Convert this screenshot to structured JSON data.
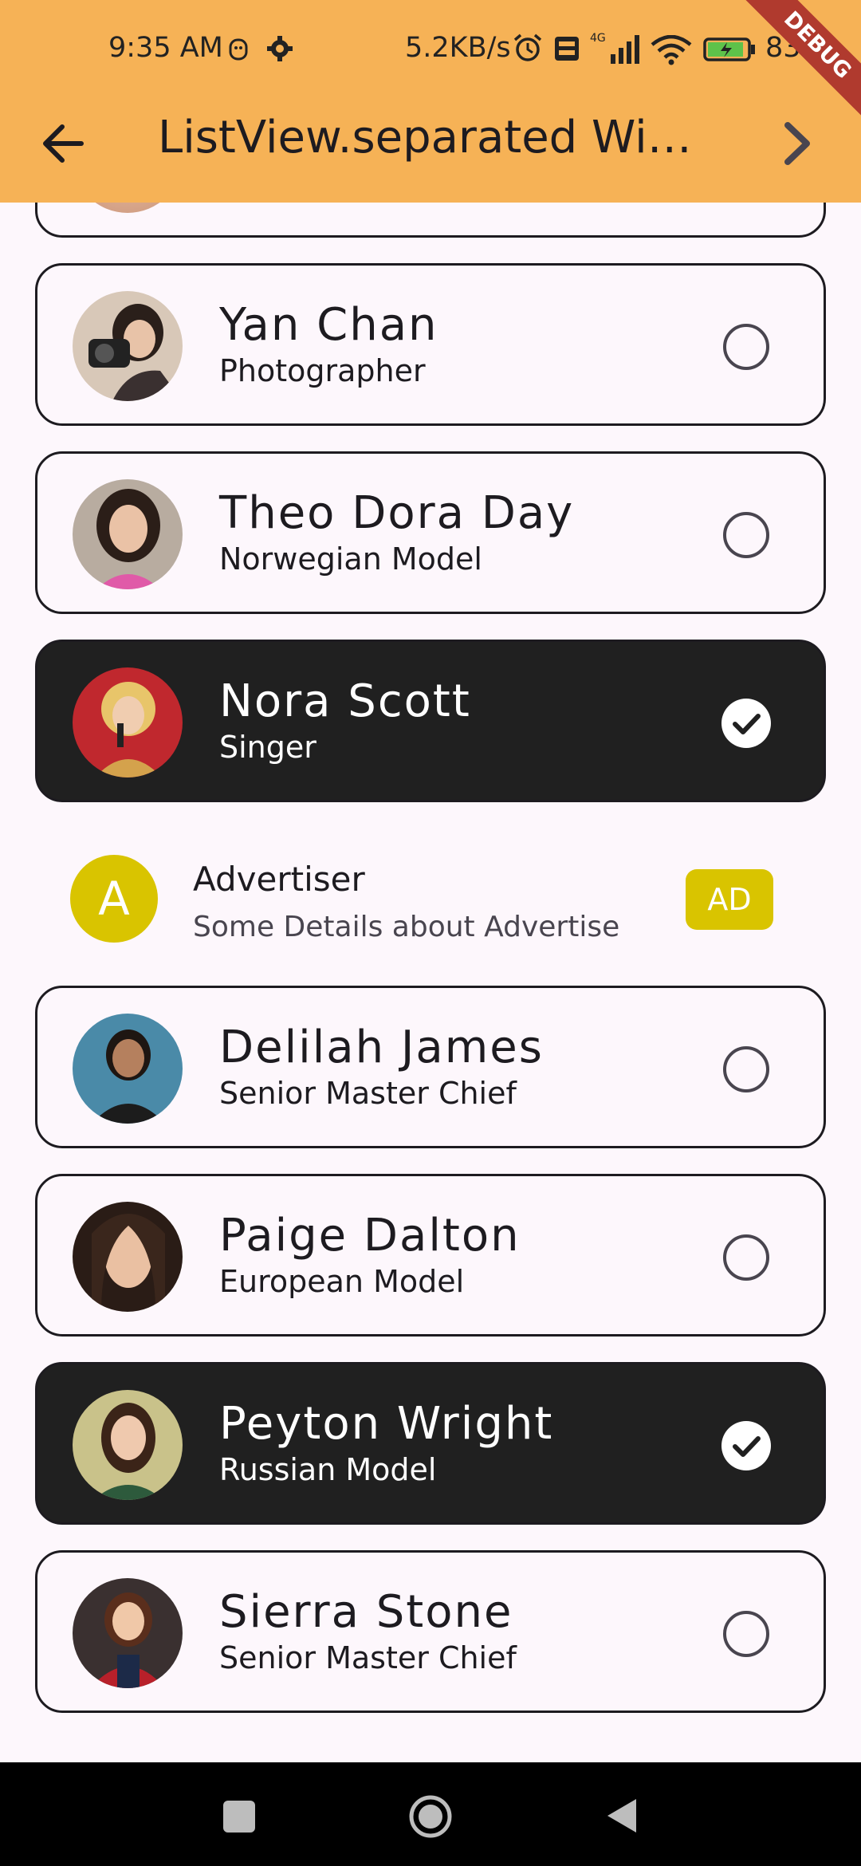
{
  "status_bar": {
    "time": "9:35 AM",
    "network_speed": "5.2KB/s",
    "battery": "83"
  },
  "debug_banner": "DEBUG",
  "toolbar": {
    "title": "ListView.separated Wid…"
  },
  "people": [
    {
      "name": "Yan Chan",
      "role": "Photographer",
      "selected": false
    },
    {
      "name": "Theo Dora Day",
      "role": "Norwegian Model",
      "selected": false
    },
    {
      "name": "Nora Scott",
      "role": "Singer",
      "selected": true
    },
    {
      "name": "Delilah James",
      "role": "Senior Master Chief",
      "selected": false
    },
    {
      "name": "Paige Dalton",
      "role": "European Model",
      "selected": false
    },
    {
      "name": "Peyton Wright",
      "role": "Russian Model",
      "selected": true
    },
    {
      "name": "Sierra Stone",
      "role": "Senior Master Chief",
      "selected": false
    }
  ],
  "advert": {
    "avatar_letter": "A",
    "title": "Advertiser",
    "subtitle": "Some Details about Advertise",
    "badge": "AD"
  },
  "colors": {
    "appbar": "#f6b256",
    "background": "#fdf7fc",
    "selected_card": "#202020",
    "ad_accent": "#d9c400"
  }
}
